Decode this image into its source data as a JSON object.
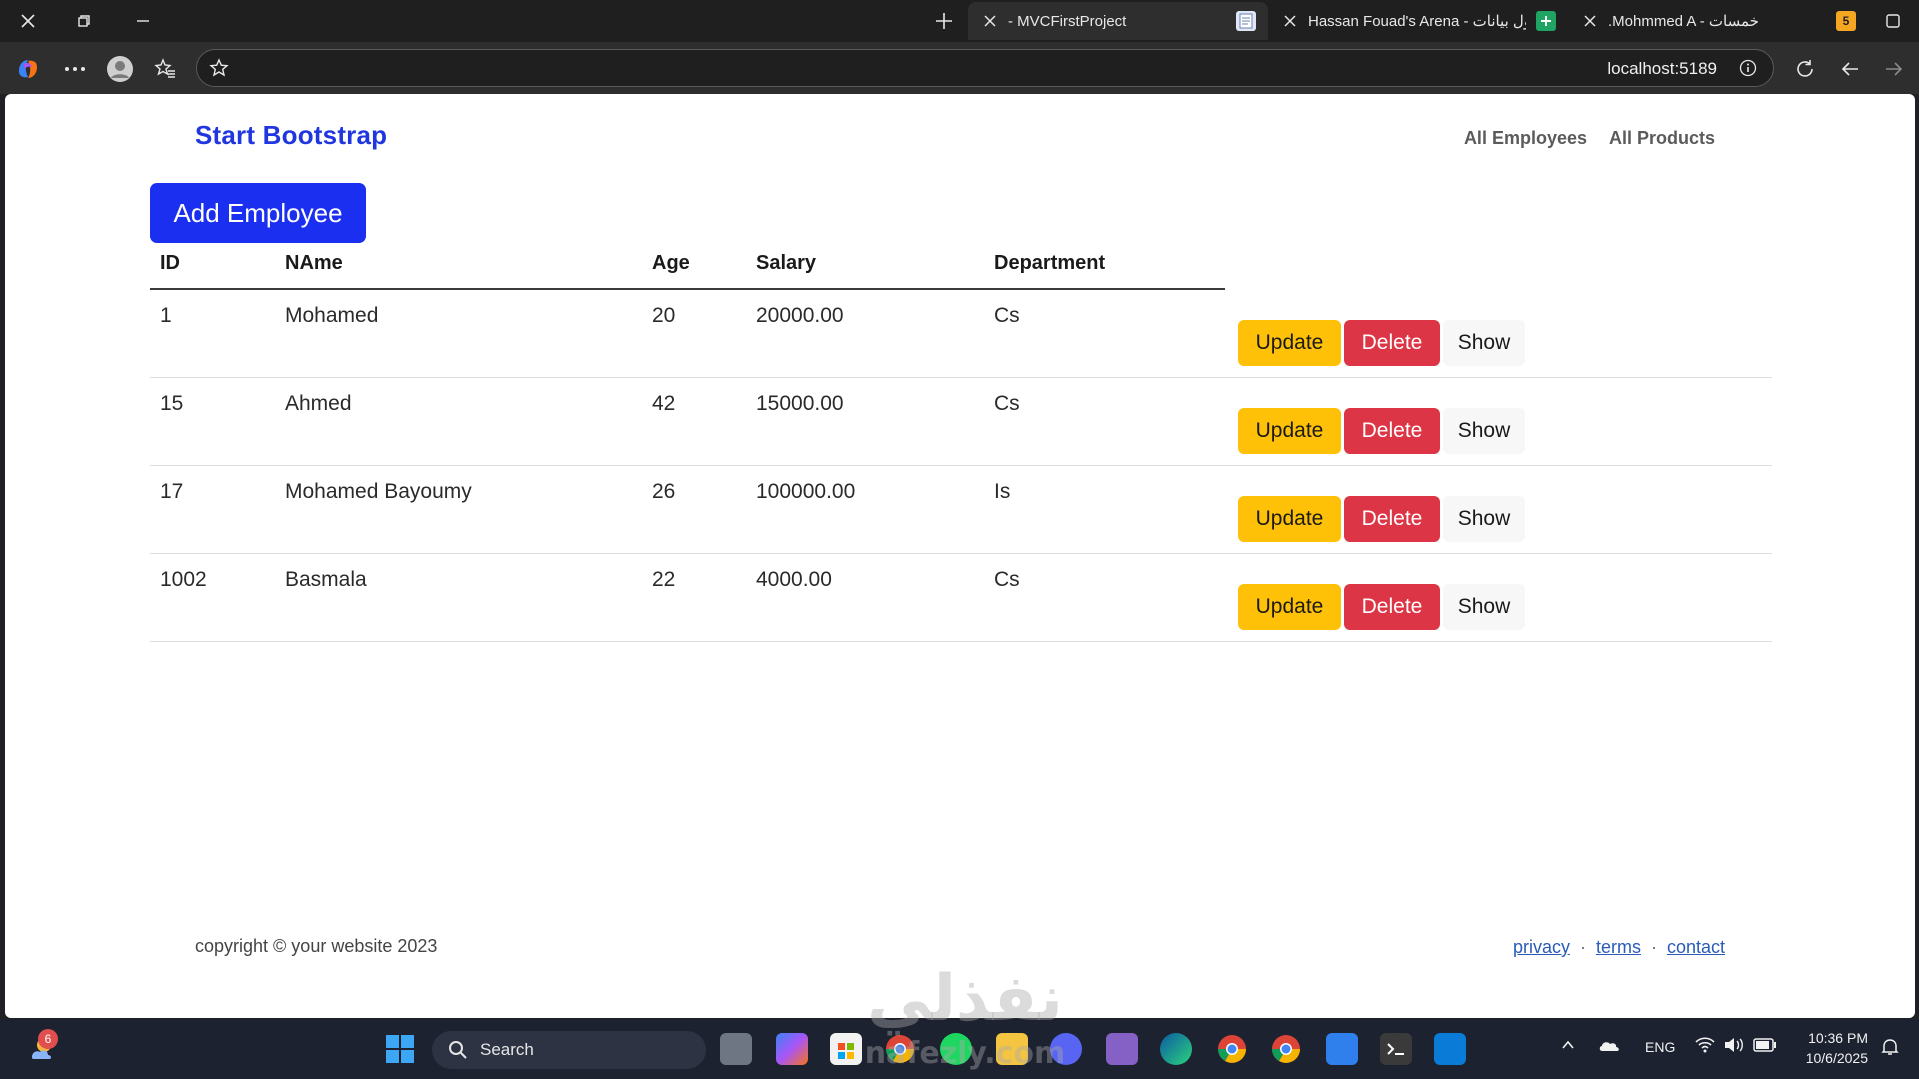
{
  "browser": {
    "tabs": [
      {
        "label": "- MVCFirstProject",
        "active": true
      },
      {
        "label": "Hassan Fouad's Arena - أول بيانات",
        "active": false
      },
      {
        "label": ".Mohmmed A - خمسات",
        "active": false
      }
    ],
    "khamsat_badge": "5",
    "url": "localhost:5189"
  },
  "page": {
    "brand": "Start Bootstrap",
    "nav": [
      "All Employees",
      "All Products"
    ],
    "add_button": "Add Employee",
    "table": {
      "headers": [
        "ID",
        "NAme",
        "Age",
        "Salary",
        "Department"
      ],
      "rows": [
        {
          "id": "1",
          "name": "Mohamed",
          "age": "20",
          "salary": "20000.00",
          "department": "Cs"
        },
        {
          "id": "15",
          "name": "Ahmed",
          "age": "42",
          "salary": "15000.00",
          "department": "Cs"
        },
        {
          "id": "17",
          "name": "Mohamed Bayoumy",
          "age": "26",
          "salary": "100000.00",
          "department": "Is"
        },
        {
          "id": "1002",
          "name": "Basmala",
          "age": "22",
          "salary": "4000.00",
          "department": "Cs"
        }
      ],
      "actions": {
        "update": "Update",
        "delete": "Delete",
        "show": "Show"
      }
    },
    "footer": {
      "copyright": "copyright © your website 2023",
      "links": [
        "privacy",
        "terms",
        "contact"
      ],
      "separator": "·"
    }
  },
  "watermark": {
    "text_ar": "نفذلي",
    "text_en": "nafezly.com"
  },
  "taskbar": {
    "notification_count": "6",
    "search_label": "Search",
    "language": "ENG",
    "time": "10:36 PM",
    "date": "10/6/2025"
  },
  "colors": {
    "brand": "#2037e0",
    "primary": "#1b2ff0",
    "warning": "#ffc107",
    "danger": "#dc3545"
  }
}
